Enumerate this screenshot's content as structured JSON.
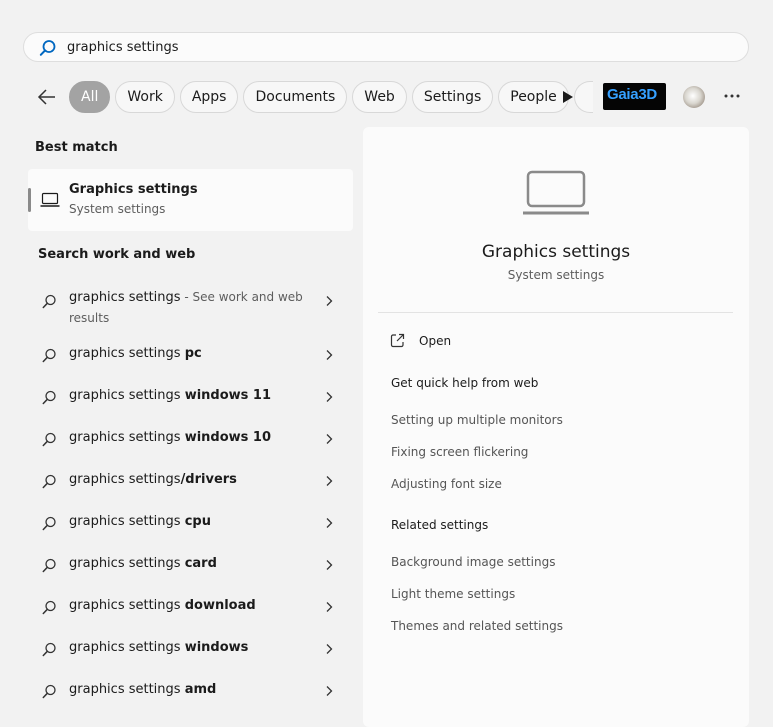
{
  "search": {
    "value": "graphics settings"
  },
  "filters": {
    "tabs": [
      "All",
      "Work",
      "Apps",
      "Documents",
      "Web",
      "Settings",
      "People"
    ],
    "active": "All",
    "logo_text": "Gaia3D"
  },
  "best_match": {
    "heading": "Best match",
    "title": "Graphics settings",
    "subtitle": "System settings"
  },
  "search_web": {
    "heading": "Search work and web",
    "first": {
      "query": "graphics settings",
      "hint": " - See work and web results"
    },
    "suggestions": [
      {
        "prefix": "graphics settings ",
        "bold": "pc"
      },
      {
        "prefix": "graphics settings ",
        "bold": "windows 11"
      },
      {
        "prefix": "graphics settings ",
        "bold": "windows 10"
      },
      {
        "prefix": "graphics settings",
        "bold": "/drivers"
      },
      {
        "prefix": "graphics settings ",
        "bold": "cpu"
      },
      {
        "prefix": "graphics settings ",
        "bold": "card"
      },
      {
        "prefix": "graphics settings ",
        "bold": "download"
      },
      {
        "prefix": "graphics settings ",
        "bold": "windows"
      },
      {
        "prefix": "graphics settings ",
        "bold": "amd"
      }
    ]
  },
  "detail": {
    "title": "Graphics settings",
    "subtitle": "System settings",
    "open_label": "Open",
    "quick_help": {
      "heading": "Get quick help from web",
      "links": [
        "Setting up multiple monitors",
        "Fixing screen flickering",
        "Adjusting font size"
      ]
    },
    "related": {
      "heading": "Related settings",
      "links": [
        "Background image settings",
        "Light theme settings",
        "Themes and related settings"
      ]
    }
  },
  "colors": {
    "accent": "#0067c0",
    "active_tab": "#a3a3a3",
    "background": "#f2f2f2",
    "panel": "#fbfbfb"
  }
}
